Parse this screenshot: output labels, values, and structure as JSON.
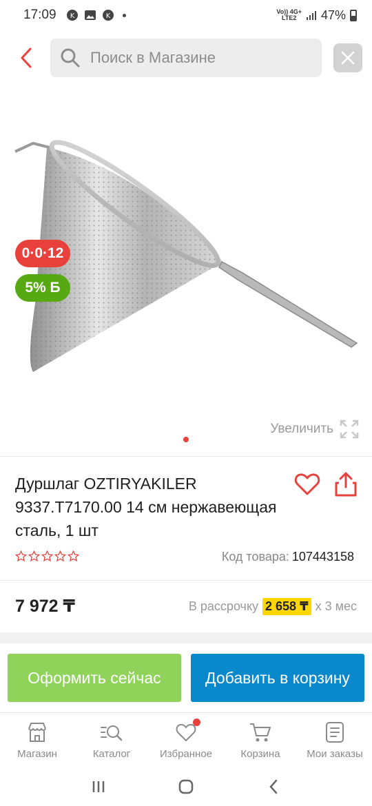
{
  "status_bar": {
    "time": "17:09",
    "network_top": "Vo)) 4G+",
    "network_bottom": "LTE2",
    "battery": "47%"
  },
  "search": {
    "placeholder": "Поиск в Магазине"
  },
  "product": {
    "badge_installment": "0·0·12",
    "badge_bonus": "5% Б",
    "zoom_label": "Увеличить",
    "title": "Дуршлаг OZTIRYAKILER 9337.T7170.00 14 см нержавеющая сталь, 1 шт",
    "rating_stars": 0,
    "sku_label": "Код товара:",
    "sku_value": "107443158",
    "price": "7 972 ₸",
    "installment_label": "В рассрочку",
    "installment_amount": "2 658 ₸",
    "installment_term": "х 3 мес"
  },
  "actions": {
    "buy_now": "Оформить сейчас",
    "add_to_cart": "Добавить в корзину"
  },
  "bottom_nav": [
    {
      "label": "Магазин",
      "icon": "store-icon"
    },
    {
      "label": "Каталог",
      "icon": "catalog-search-icon"
    },
    {
      "label": "Избранное",
      "icon": "heart-icon"
    },
    {
      "label": "Корзина",
      "icon": "cart-icon"
    },
    {
      "label": "Мои заказы",
      "icon": "orders-icon"
    }
  ],
  "colors": {
    "accent_red": "#e8403a",
    "bonus_green": "#57a913",
    "buy_button": "#8fd35b",
    "cart_button": "#0a88cc",
    "installment_highlight": "#ffd600"
  }
}
